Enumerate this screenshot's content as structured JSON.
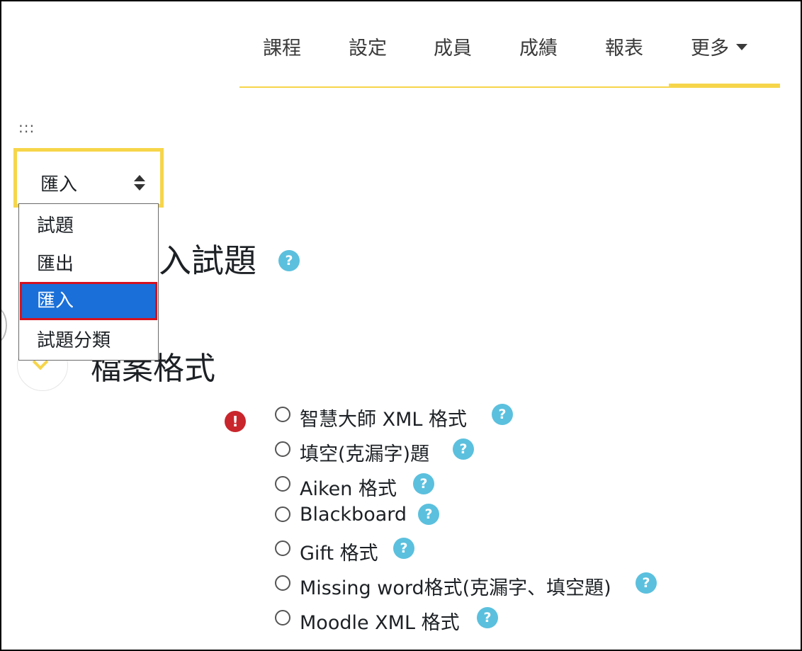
{
  "nav": {
    "items": [
      "課程",
      "設定",
      "成員",
      "成績",
      "報表"
    ],
    "more_label": "更多"
  },
  "breadcrumb_dots": ":::",
  "select": {
    "value": "匯入",
    "options": [
      "試題",
      "匯出",
      "匯入",
      "試題分類"
    ],
    "selected_index": 2
  },
  "headings": {
    "import_title": "入試題",
    "file_format": "檔案格式"
  },
  "help_symbol": "?",
  "required_symbol": "!",
  "formats": [
    "智慧大師 XML 格式",
    "填空(克漏字)題",
    "Aiken 格式",
    "Blackboard",
    "Gift 格式",
    "Missing word格式(克漏字、填空題)",
    "Moodle XML 格式"
  ],
  "colors": {
    "accent_yellow": "#f6d54a",
    "selected_blue": "#1a6fd8",
    "highlight_red": "#d4121f",
    "help_blue": "#5bc0de",
    "error_red": "#c9252c"
  }
}
